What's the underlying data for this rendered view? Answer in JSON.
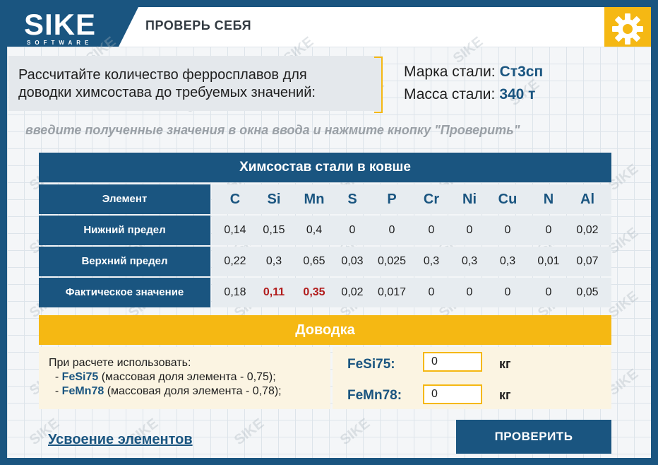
{
  "brand": {
    "logo_text": "SIKE",
    "logo_sub": "SOFTWARE"
  },
  "header": {
    "title": "ПРОВЕРЬ СЕБЯ",
    "settings_icon": "gear-icon"
  },
  "watermark": "SIKE",
  "task": {
    "line1": "Рассчитайте количество ферросплавов для",
    "line2": "доводки химсостава до требуемых значений:"
  },
  "steel": {
    "grade_label": "Марка стали:",
    "grade_value": "Ст3сп",
    "mass_label": "Масса стали:",
    "mass_value": "340 т"
  },
  "hint": "введите полученные значения в окна ввода и нажмите кнопку \"Проверить\"",
  "chem_table": {
    "title": "Химсостав стали в ковше",
    "header_label": "Элемент",
    "elements": [
      "C",
      "Si",
      "Mn",
      "S",
      "P",
      "Cr",
      "Ni",
      "Cu",
      "N",
      "Al"
    ],
    "rows": [
      {
        "label": "Нижний предел",
        "values": [
          "0,14",
          "0,15",
          "0,4",
          "0",
          "0",
          "0",
          "0",
          "0",
          "0",
          "0,02"
        ],
        "highlight": [
          false,
          false,
          false,
          false,
          false,
          false,
          false,
          false,
          false,
          false
        ]
      },
      {
        "label": "Верхний предел",
        "values": [
          "0,22",
          "0,3",
          "0,65",
          "0,03",
          "0,025",
          "0,3",
          "0,3",
          "0,3",
          "0,01",
          "0,07"
        ],
        "highlight": [
          false,
          false,
          false,
          false,
          false,
          false,
          false,
          false,
          false,
          false
        ]
      },
      {
        "label": "Фактическое значение",
        "values": [
          "0,18",
          "0,11",
          "0,35",
          "0,02",
          "0,017",
          "0",
          "0",
          "0",
          "0",
          "0,05"
        ],
        "highlight": [
          false,
          true,
          true,
          false,
          false,
          false,
          false,
          false,
          false,
          false
        ]
      }
    ]
  },
  "dovodka": {
    "title": "Доводка",
    "intro": "При расчете использовать:",
    "item1_name": "FeSi75",
    "item1_desc": "(массовая доля элемента - 0,75);",
    "item2_name": "FeMn78",
    "item2_desc": "(массовая доля элемента - 0,78);",
    "fesi_label": "FeSi75:",
    "fesi_value": "0",
    "fesi_unit": "кг",
    "femn_label": "FeMn78:",
    "femn_value": "0",
    "femn_unit": "кг"
  },
  "footer": {
    "link_label": "Усвоение элементов",
    "check_button": "ПРОВЕРИТЬ"
  },
  "colors": {
    "primary": "#1a5580",
    "accent": "#f5b813",
    "error": "#b11b1b"
  }
}
